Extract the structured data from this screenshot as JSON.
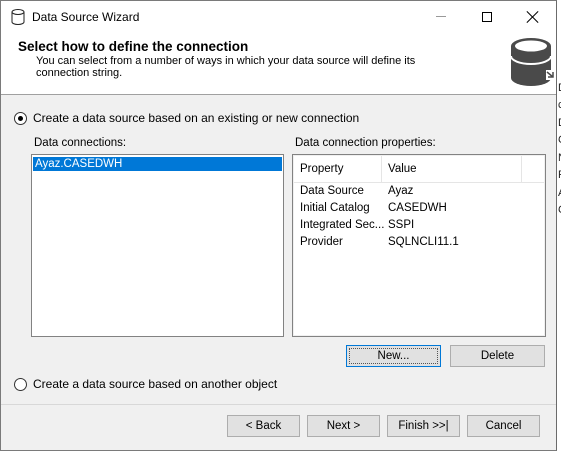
{
  "window": {
    "title": "Data Source Wizard"
  },
  "header": {
    "title": "Select how to define the connection",
    "description": "You can select from a number of ways in which your data source will define its connection string.",
    "icon": "database-icon"
  },
  "options": {
    "existing_connection": {
      "label": "Create a data source based on an existing or new connection",
      "checked": true
    },
    "another_object": {
      "label": "Create a data source based on another object",
      "checked": false
    }
  },
  "connections": {
    "label": "Data connections:",
    "items": [
      "Ayaz.CASEDWH"
    ],
    "selected": "Ayaz.CASEDWH"
  },
  "properties": {
    "label": "Data connection properties:",
    "columns": [
      "Property",
      "Value"
    ],
    "rows": [
      {
        "property": "Data Source",
        "value": "Ayaz"
      },
      {
        "property": "Initial Catalog",
        "value": "CASEDWH"
      },
      {
        "property": "Integrated Sec...",
        "value": "SSPI"
      },
      {
        "property": "Provider",
        "value": "SQLNCLI11.1"
      }
    ]
  },
  "actions": {
    "new_label": "New...",
    "delete_label": "Delete"
  },
  "footer": {
    "back_label": "< Back",
    "next_label": "Next >",
    "finish_label": "Finish >>|",
    "cancel_label": "Cancel"
  },
  "background_window": {
    "letters": [
      "D",
      "c",
      "D",
      "C",
      "N",
      "F",
      "A",
      "C"
    ]
  },
  "colors": {
    "selection": "#0078d7",
    "dialog_bg": "#f0f0f0",
    "header_bg": "#ffffff"
  }
}
